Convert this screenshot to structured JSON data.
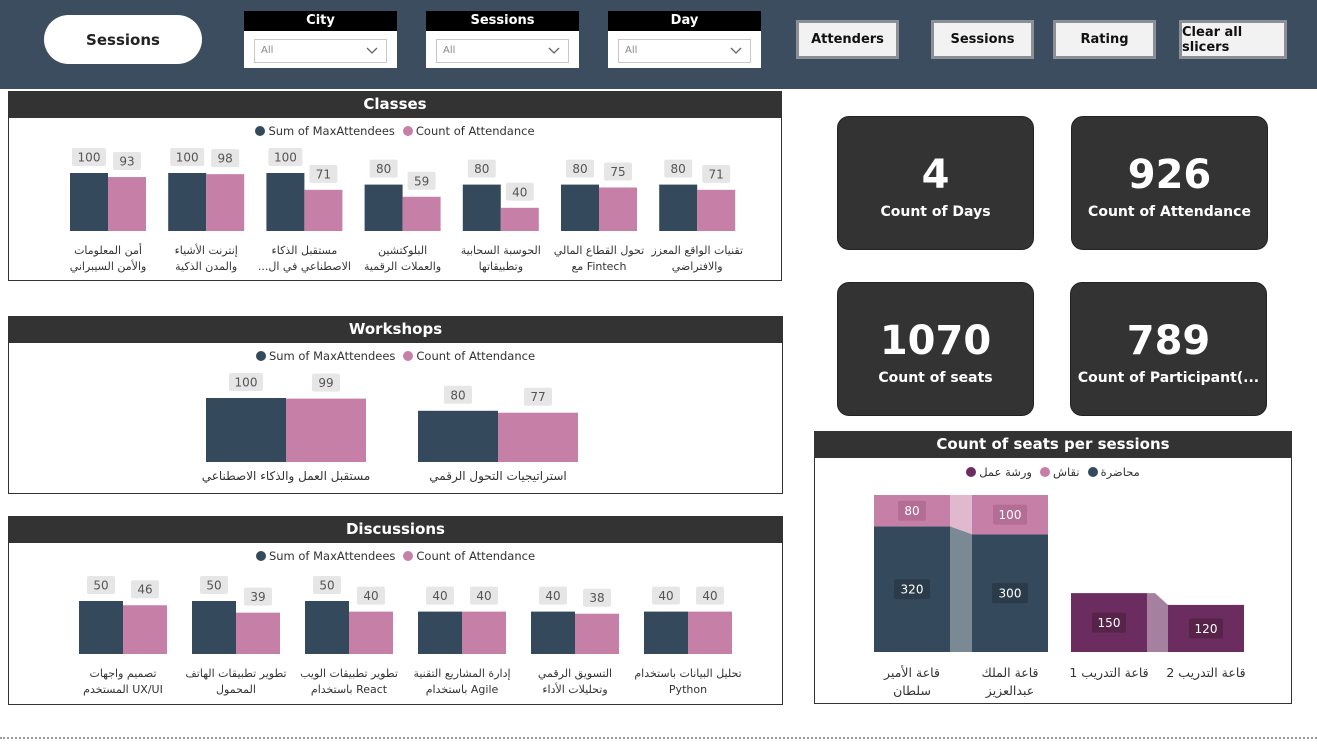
{
  "topbar": {
    "page_button": "Sessions",
    "slicers": [
      {
        "title": "City",
        "value": "All"
      },
      {
        "title": "Sessions",
        "value": "All"
      },
      {
        "title": "Day",
        "value": "All"
      }
    ],
    "nav_buttons": [
      "Attenders",
      "Sessions",
      "Rating",
      "Clear all slicers"
    ]
  },
  "colors": {
    "max_attendees": "#344a5c",
    "attendance": "#c67fa7",
    "muhadara": "#344a5c",
    "niqash": "#c67fa7",
    "warsha": "#6b2d5f"
  },
  "panels": {
    "classes": {
      "title": "Classes",
      "legend": [
        "Sum of MaxAttendees",
        "Count of Attendance"
      ],
      "chart_data": {
        "type": "bar",
        "categories": [
          [
            "أمن المعلومات",
            "والأمن السيبراني"
          ],
          [
            "إنترنت الأشياء",
            "والمدن الذكية"
          ],
          [
            "مستقبل الذكاء",
            "...الاصطناعي في ال"
          ],
          [
            "البلوكتشين",
            "والعملات الرقمية"
          ],
          [
            "الحوسبة السحابية",
            "وتطبيقاتها"
          ],
          [
            "تحول القطاع المالي",
            "مع Fintech"
          ],
          [
            "تقنيات الواقع المعزز",
            "والافتراضي"
          ]
        ],
        "series": [
          {
            "name": "Sum of MaxAttendees",
            "values": [
              100,
              100,
              100,
              80,
              80,
              80,
              80
            ]
          },
          {
            "name": "Count of Attendance",
            "values": [
              93,
              98,
              71,
              59,
              40,
              75,
              71
            ]
          }
        ],
        "ylim": [
          0,
          100
        ]
      }
    },
    "workshops": {
      "title": "Workshops",
      "legend": [
        "Sum of MaxAttendees",
        "Count of Attendance"
      ],
      "chart_data": {
        "type": "bar",
        "categories": [
          [
            "مستقبل العمل والذكاء الاصطناعي"
          ],
          [
            "استراتيجيات التحول الرقمي"
          ]
        ],
        "series": [
          {
            "name": "Sum of MaxAttendees",
            "values": [
              100,
              80
            ]
          },
          {
            "name": "Count of Attendance",
            "values": [
              99,
              77
            ]
          }
        ],
        "ylim": [
          0,
          100
        ]
      }
    },
    "discussions": {
      "title": "Discussions",
      "legend": [
        "Sum of MaxAttendees",
        "Count of Attendance"
      ],
      "chart_data": {
        "type": "bar",
        "categories": [
          [
            "تصميم واجهات",
            "المستخدم UX/UI"
          ],
          [
            "تطوير تطبيقات الهاتف",
            "المحمول"
          ],
          [
            "تطوير تطبيقات الويب",
            "باستخدام React"
          ],
          [
            "إدارة المشاريع التقنية",
            "باستخدام Agile"
          ],
          [
            "التسويق الرقمي",
            "وتحليلات الأداء"
          ],
          [
            "تحليل البيانات باستخدام",
            "Python"
          ]
        ],
        "series": [
          {
            "name": "Sum of MaxAttendees",
            "values": [
              50,
              50,
              50,
              40,
              40,
              40
            ]
          },
          {
            "name": "Count of Attendance",
            "values": [
              46,
              39,
              40,
              40,
              38,
              40
            ]
          }
        ],
        "ylim": [
          0,
          50
        ]
      }
    },
    "seats": {
      "title": "Count of seats per sessions",
      "legend": [
        "محاضرة",
        "نقاش",
        "ورشة عمل"
      ],
      "chart_data": {
        "type": "bar",
        "stacked": true,
        "categories": [
          [
            "قاعة الأمير",
            "سلطان"
          ],
          [
            "قاعة الملك",
            "عبدالعزيز"
          ],
          [
            "قاعة التدريب 1"
          ],
          [
            "قاعة التدريب 2"
          ]
        ],
        "series": [
          {
            "name": "محاضرة",
            "values": [
              320,
              300,
              null,
              null
            ]
          },
          {
            "name": "نقاش",
            "values": [
              80,
              100,
              null,
              null
            ]
          },
          {
            "name": "ورشة عمل",
            "values": [
              null,
              null,
              150,
              120
            ]
          }
        ],
        "ylim": [
          0,
          400
        ]
      }
    }
  },
  "kpis": [
    {
      "value": "4",
      "label": "Count of Days"
    },
    {
      "value": "926",
      "label": "Count of Attendance"
    },
    {
      "value": "1070",
      "label": "Count of seats"
    },
    {
      "value": "789",
      "label": "Count of Participant(..."
    }
  ]
}
